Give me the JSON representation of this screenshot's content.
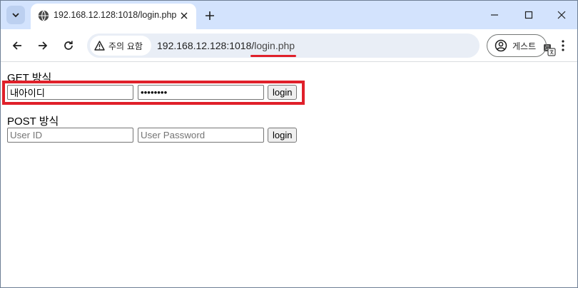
{
  "tab": {
    "title": "192.168.12.128:1018/login.php"
  },
  "window_controls": {
    "minimize": "minimize",
    "maximize": "maximize",
    "close": "close"
  },
  "toolbar": {
    "security_label": "주의 요함",
    "url_host": "192.168.12.128:1018/",
    "url_path": "login.php",
    "profile_label": "게스트"
  },
  "get_form": {
    "title": "GET 방식",
    "id_value": "내아이디",
    "password_value": "password",
    "submit_label": "login"
  },
  "post_form": {
    "title": "POST 방식",
    "id_placeholder": "User ID",
    "password_placeholder": "User Password",
    "submit_label": "login"
  },
  "colors": {
    "tabstrip": "#d3e3fd",
    "omnibox": "#e9eef6",
    "highlight": "#e0202a"
  },
  "icons": [
    "tab-search-icon",
    "globe-icon",
    "close-icon",
    "plus-icon",
    "minimize-icon",
    "maximize-icon",
    "window-close-icon",
    "back-arrow-icon",
    "forward-arrow-icon",
    "reload-icon",
    "warning-icon",
    "translate-icon",
    "profile-icon",
    "kebab-menu-icon"
  ]
}
